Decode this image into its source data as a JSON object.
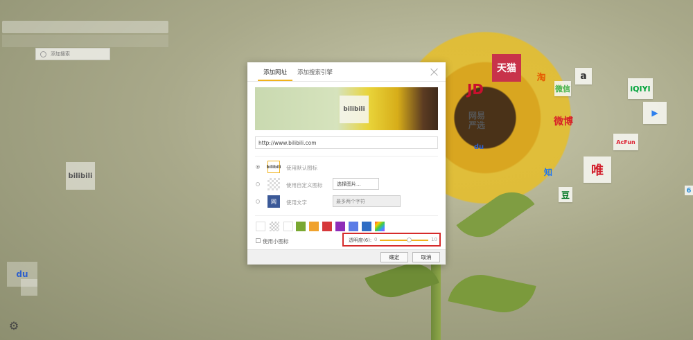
{
  "background": {
    "search_engine_button": "添加搜索",
    "tiles": {
      "bilibili": "bilibili",
      "baidu": "du",
      "tmall": "天猫",
      "taobao": "淘",
      "amazon": "a",
      "jd": "JD",
      "wechat": "微信",
      "iqiyi": "iQIYI",
      "wangyi_line1": "网易",
      "wangyi_line2": "严选",
      "weibo": "微博",
      "tencent_video": "▶",
      "acfun": "AcFun",
      "baidu_small": "du",
      "wei": "唯",
      "zhihu": "知",
      "douban": "豆",
      "side": "6"
    },
    "settings_icon": "gear-icon"
  },
  "dialog": {
    "tabs": [
      "添加网址",
      "添加搜索引擎"
    ],
    "active_tab": 0,
    "preview_tile_label": "bilibili",
    "url_value": "http://www.bilibili.com",
    "icon_options": [
      {
        "label": "使用默认图标",
        "icon_text": "bilibili",
        "selected": true
      },
      {
        "label": "使用自定义图标",
        "icon_text": "",
        "selected": false
      },
      {
        "label": "使用文字",
        "icon_text": "网",
        "selected": false
      }
    ],
    "choose_image_label": "选择图片...",
    "text_placeholder": "最多两个字符",
    "colors": [
      "#ffffff",
      "transparent",
      "#ffffff",
      "#7aa832",
      "#f0a22d",
      "#d6383a",
      "#8e2db8",
      "#5b7be6",
      "#2f6dc4",
      "rainbow"
    ],
    "small_icon_label": "使用小图标",
    "opacity": {
      "label": "透明度(6):",
      "min": "0",
      "max": "10",
      "value": 6
    },
    "ok_label": "确定",
    "cancel_label": "取消"
  }
}
